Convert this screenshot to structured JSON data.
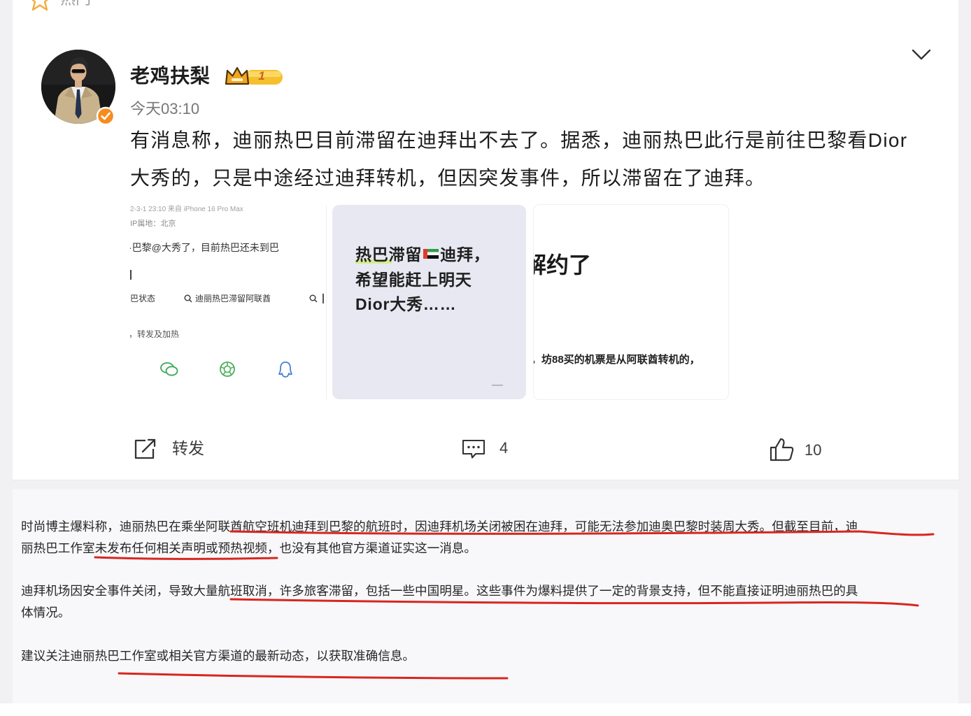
{
  "top_tab": {
    "label": "热门",
    "icon": "star-icon"
  },
  "post": {
    "author": "老鸡扶梨",
    "level": "1",
    "time": "今天03:10",
    "text_lines": [
      "有消息称，迪丽热巴目前滞留在迪拜出不去了。据悉，迪丽热巴此行是前往巴黎看Dior",
      "大秀的，只是中途经过迪拜转机，但因突发事件，所以滞留在了迪拜。"
    ],
    "images": {
      "first": {
        "meta_line": "2-3-1 23:10 来自 iPhone 16 Pro Max",
        "location_line": "IP属地：北京",
        "body_line": "·巴黎@大秀了，目前热巴还未到巴",
        "chip_1": "巴状态",
        "chip_2": "迪丽热巴滞留阿联酋",
        "footer_line": "，转发及加热"
      },
      "second": {
        "line_1_before_flag": "热巴滞留",
        "line_1_after_flag": "迪拜，",
        "line_2": "希望能赶上明天",
        "line_3": "Dior大秀……"
      },
      "third": {
        "headline": "解约了",
        "footer_line": "，坊88买的机票是从阿联酋转机的，"
      }
    },
    "actions": {
      "share_label": "转发",
      "comment_count": "4",
      "like_count": "10"
    }
  },
  "commentary": {
    "paragraphs": [
      {
        "lines": [
          "时尚博主爆料称，迪丽热巴在乘坐阿联酋航空班机迪拜到巴黎的航班时，因迪拜机场关闭被困在迪拜，可能无法参加迪奥巴黎时装周大秀。但截至目前，迪",
          "丽热巴工作室未发布任何相关声明或预热视频，也没有其他官方渠道证实这一消息。"
        ]
      },
      {
        "lines": [
          "迪拜机场因安全事件关闭，导致大量航班取消，许多旅客滞留，包括一些中国明星。这些事件为爆料提供了一定的背景支持，但不能直接证明迪丽热巴的具",
          "体情况。"
        ]
      },
      {
        "lines": [
          "建议关注迪丽热巴工作室或相关官方渠道的最新动态，以获取准确信息。"
        ]
      }
    ]
  },
  "icons": {
    "verified": "verified-badge-icon",
    "level": "crown-icon",
    "menu": "chevron-down-icon",
    "share": "share-icon",
    "comment": "comment-icon",
    "like": "thumbs-up-icon"
  },
  "colors": {
    "verified_orange": "#f78b1e",
    "level_gold": "#f6c02c",
    "underline_red": "#d8261f",
    "text_primary": "#1d1d1d",
    "text_secondary": "#777777",
    "image_card_lavender": "#e8e8f2"
  }
}
